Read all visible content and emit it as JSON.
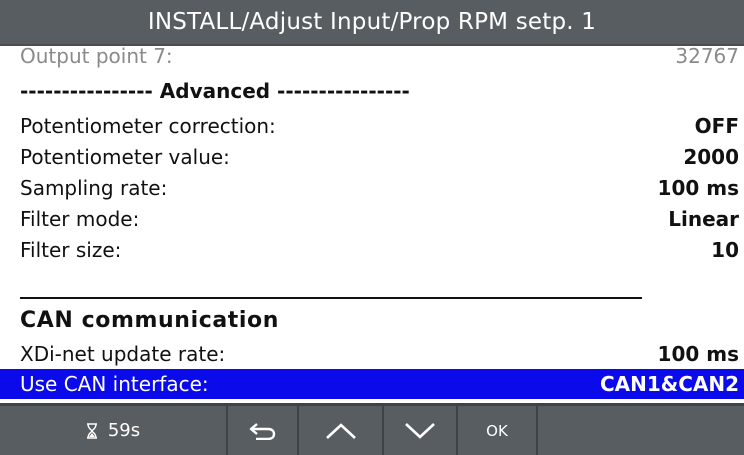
{
  "title": "INSTALL/Adjust Input/Prop RPM setp. 1",
  "partial_row": {
    "label": "Output point 7:",
    "value": "32767"
  },
  "advanced_separator": "---------------- Advanced ----------------",
  "rows": [
    {
      "label": "Potentiometer correction:",
      "value": "OFF"
    },
    {
      "label": "Potentiometer value:",
      "value": "2000"
    },
    {
      "label": "Sampling rate:",
      "value": "100 ms"
    },
    {
      "label": "Filter mode:",
      "value": "Linear"
    },
    {
      "label": "Filter size:",
      "value": "10"
    }
  ],
  "can_section": {
    "title": "CAN communication",
    "rows": [
      {
        "label": "XDi-net update rate:",
        "value": "100 ms"
      },
      {
        "label": "Use CAN interface:",
        "value": "CAN1&CAN2",
        "selected": true
      }
    ]
  },
  "footer": {
    "timer_icon": "hourglass-icon",
    "timer_text": "59s",
    "back_icon": "back-arrow-icon",
    "up_icon": "chevron-up-icon",
    "down_icon": "chevron-down-icon",
    "ok_label": "OK"
  },
  "colors": {
    "title_bar": "#585d62",
    "selection": "#0a0aeb",
    "text": "#111111"
  }
}
